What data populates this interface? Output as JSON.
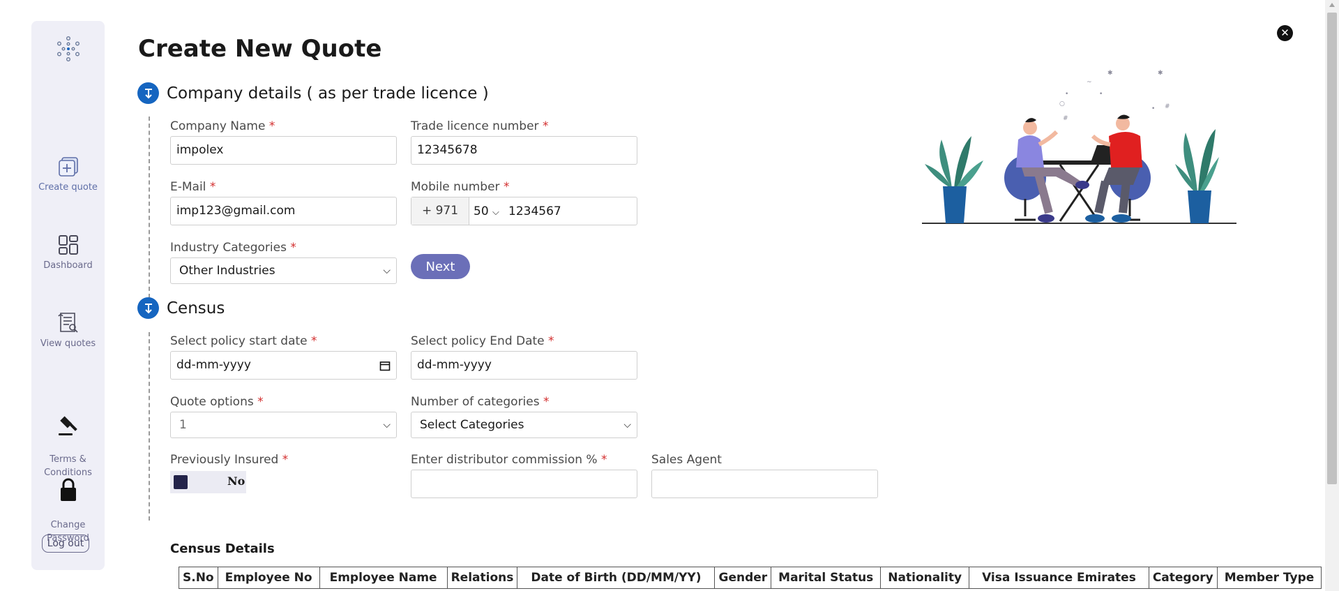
{
  "sidebar": {
    "items": [
      {
        "label": "Create quote",
        "icon": "create-quote-icon"
      },
      {
        "label": "Dashboard",
        "icon": "dashboard-icon"
      },
      {
        "label": "View quotes",
        "icon": "view-quotes-icon"
      },
      {
        "label": "Terms &\nConditions",
        "icon": "gavel-icon"
      },
      {
        "label": "Change\nPassword",
        "icon": "lock-icon"
      }
    ],
    "logout_label": "Log out"
  },
  "page": {
    "title": "Create New Quote",
    "close_icon": "close-icon"
  },
  "company_section": {
    "title": "Company details ( as per trade licence )",
    "company_name": {
      "label": "Company Name",
      "value": "impolex"
    },
    "trade_licence": {
      "label": "Trade licence number",
      "value": "12345678"
    },
    "email": {
      "label": "E-Mail",
      "value": "imp123@gmail.com"
    },
    "mobile": {
      "label": "Mobile number",
      "country_code": "+ 971",
      "operator": "50",
      "number": "1234567"
    },
    "industry": {
      "label": "Industry Categories",
      "value": "Other Industries"
    },
    "next_label": "Next"
  },
  "census_section": {
    "title": "Census",
    "start_date": {
      "label": "Select policy start date",
      "value": "dd-mm-yyyy"
    },
    "end_date": {
      "label": "Select policy End Date",
      "value": "dd-mm-yyyy"
    },
    "quote_options": {
      "label": "Quote options",
      "value": "1"
    },
    "num_categories": {
      "label": "Number of categories",
      "value": "Select Categories"
    },
    "previously_insured": {
      "label": "Previously Insured",
      "value": "No"
    },
    "commission": {
      "label": "Enter distributor commission %",
      "value": ""
    },
    "sales_agent": {
      "label": "Sales Agent",
      "value": ""
    },
    "details_title": "Census Details",
    "table_headers": [
      "S.No",
      "Employee No",
      "Employee Name",
      "Relations",
      "Date of Birth (DD/MM/YY)",
      "Gender",
      "Marital Status",
      "Nationality",
      "Visa Issuance Emirates",
      "Category",
      "Member Type"
    ]
  },
  "colors": {
    "accent": "#1565c0",
    "next_button": "#6b6fb8",
    "sidebar_bg": "#efeff7",
    "required": "#d32f2f"
  }
}
